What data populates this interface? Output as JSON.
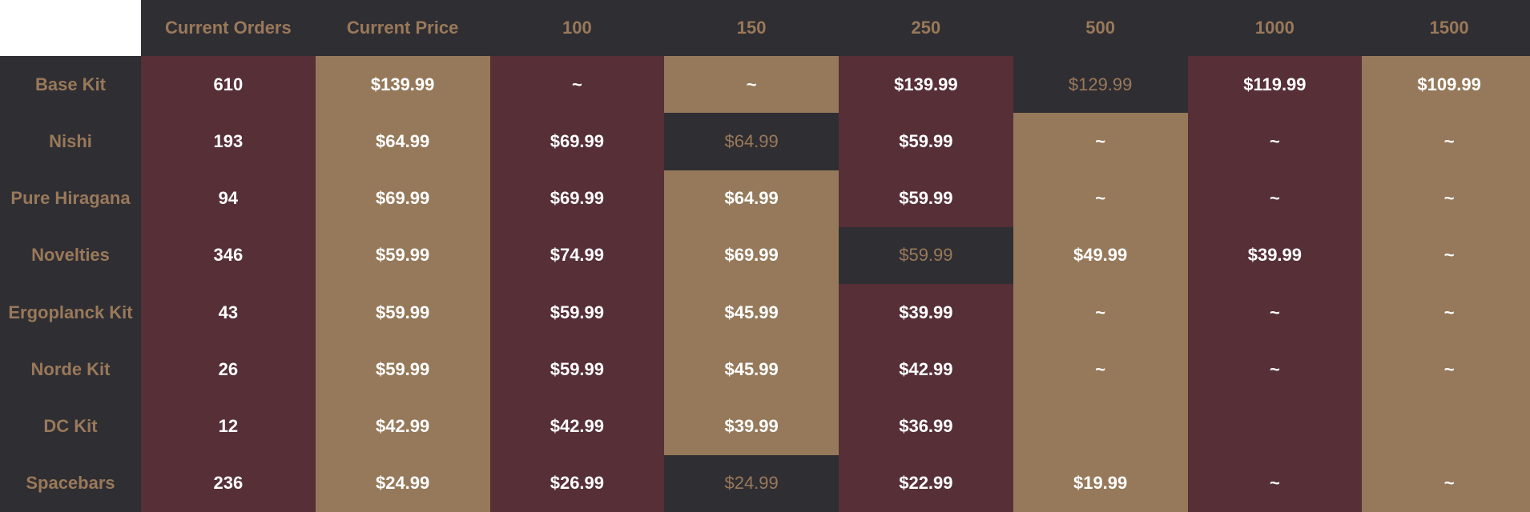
{
  "colors": {
    "maroon": "#562f37",
    "tan": "#95795a",
    "dark": "#2f2e33",
    "header_text": "#99795a",
    "cell_text": "#ffffff",
    "corner": "#ffffff"
  },
  "headers": [
    "Current Orders",
    "Current Price",
    "100",
    "150",
    "250",
    "500",
    "1000",
    "1500"
  ],
  "rows": [
    {
      "name": "Base Kit",
      "cells": [
        {
          "v": "610",
          "bg": "m"
        },
        {
          "v": "$139.99",
          "bg": "t"
        },
        {
          "v": "~",
          "bg": "m"
        },
        {
          "v": "~",
          "bg": "t"
        },
        {
          "v": "$139.99",
          "bg": "m"
        },
        {
          "v": "$129.99",
          "bg": "d"
        },
        {
          "v": "$119.99",
          "bg": "m"
        },
        {
          "v": "$109.99",
          "bg": "t"
        }
      ]
    },
    {
      "name": "Nishi",
      "cells": [
        {
          "v": "193",
          "bg": "m"
        },
        {
          "v": "$64.99",
          "bg": "t"
        },
        {
          "v": "$69.99",
          "bg": "m"
        },
        {
          "v": "$64.99",
          "bg": "d"
        },
        {
          "v": "$59.99",
          "bg": "m"
        },
        {
          "v": "~",
          "bg": "t"
        },
        {
          "v": "~",
          "bg": "m"
        },
        {
          "v": "~",
          "bg": "t"
        }
      ]
    },
    {
      "name": "Pure Hiragana",
      "cells": [
        {
          "v": "94",
          "bg": "m"
        },
        {
          "v": "$69.99",
          "bg": "t"
        },
        {
          "v": "$69.99",
          "bg": "m"
        },
        {
          "v": "$64.99",
          "bg": "t"
        },
        {
          "v": "$59.99",
          "bg": "m"
        },
        {
          "v": "~",
          "bg": "t"
        },
        {
          "v": "~",
          "bg": "m"
        },
        {
          "v": "~",
          "bg": "t"
        }
      ]
    },
    {
      "name": "Novelties",
      "cells": [
        {
          "v": "346",
          "bg": "m"
        },
        {
          "v": "$59.99",
          "bg": "t"
        },
        {
          "v": "$74.99",
          "bg": "m"
        },
        {
          "v": "$69.99",
          "bg": "t"
        },
        {
          "v": "$59.99",
          "bg": "d"
        },
        {
          "v": "$49.99",
          "bg": "t"
        },
        {
          "v": "$39.99",
          "bg": "m"
        },
        {
          "v": "~",
          "bg": "t"
        }
      ]
    },
    {
      "name": "Ergoplanck Kit",
      "cells": [
        {
          "v": "43",
          "bg": "m"
        },
        {
          "v": "$59.99",
          "bg": "t"
        },
        {
          "v": "$59.99",
          "bg": "m"
        },
        {
          "v": "$45.99",
          "bg": "t"
        },
        {
          "v": "$39.99",
          "bg": "m"
        },
        {
          "v": "~",
          "bg": "t"
        },
        {
          "v": "~",
          "bg": "m"
        },
        {
          "v": "~",
          "bg": "t"
        }
      ]
    },
    {
      "name": "Norde Kit",
      "cells": [
        {
          "v": "26",
          "bg": "m"
        },
        {
          "v": "$59.99",
          "bg": "t"
        },
        {
          "v": "$59.99",
          "bg": "m"
        },
        {
          "v": "$45.99",
          "bg": "t"
        },
        {
          "v": "$42.99",
          "bg": "m"
        },
        {
          "v": "~",
          "bg": "t"
        },
        {
          "v": "~",
          "bg": "m"
        },
        {
          "v": "~",
          "bg": "t"
        }
      ]
    },
    {
      "name": "DC Kit",
      "cells": [
        {
          "v": "12",
          "bg": "m"
        },
        {
          "v": "$42.99",
          "bg": "t"
        },
        {
          "v": "$42.99",
          "bg": "m"
        },
        {
          "v": "$39.99",
          "bg": "t"
        },
        {
          "v": "$36.99",
          "bg": "m"
        },
        {
          "v": "",
          "bg": "t"
        },
        {
          "v": "",
          "bg": "m"
        },
        {
          "v": "",
          "bg": "t"
        }
      ]
    },
    {
      "name": "Spacebars",
      "cells": [
        {
          "v": "236",
          "bg": "m"
        },
        {
          "v": "$24.99",
          "bg": "t"
        },
        {
          "v": "$26.99",
          "bg": "m"
        },
        {
          "v": "$24.99",
          "bg": "d"
        },
        {
          "v": "$22.99",
          "bg": "m"
        },
        {
          "v": "$19.99",
          "bg": "t"
        },
        {
          "v": "~",
          "bg": "m"
        },
        {
          "v": "~",
          "bg": "t"
        }
      ]
    }
  ]
}
